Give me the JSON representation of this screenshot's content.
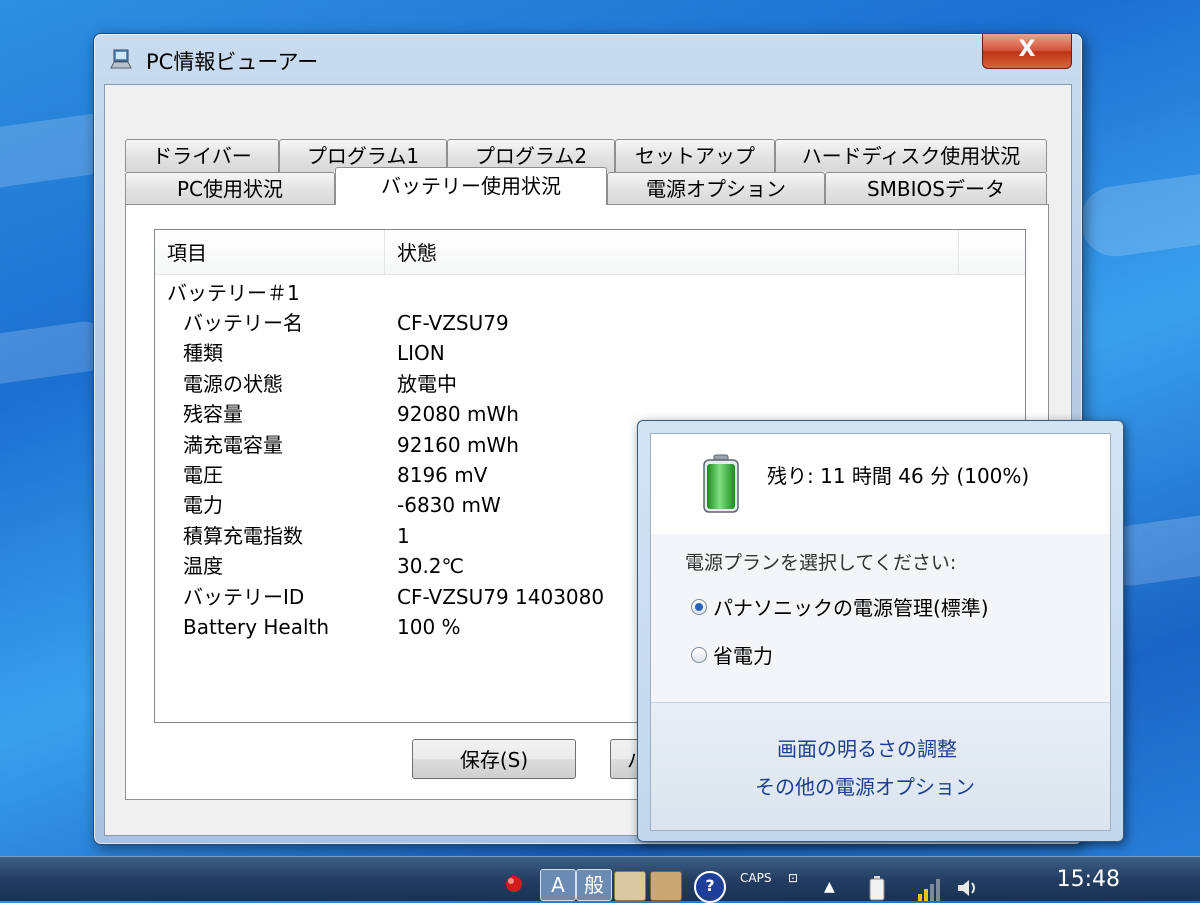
{
  "window": {
    "title": "PC情報ビューアー",
    "close_label": "X"
  },
  "tabs": {
    "row1": [
      "ドライバー",
      "プログラム1",
      "プログラム2",
      "セットアップ",
      "ハードディスク使用状況"
    ],
    "row2": [
      "PC使用状況",
      "バッテリー使用状況",
      "電源オプション",
      "SMBIOSデータ"
    ],
    "active": "バッテリー使用状況"
  },
  "list": {
    "headers": [
      "項目",
      "状態"
    ],
    "group": "バッテリー＃1",
    "rows": [
      {
        "item": "バッテリー名",
        "value": "CF-VZSU79"
      },
      {
        "item": "種類",
        "value": "LION"
      },
      {
        "item": "電源の状態",
        "value": "放電中"
      },
      {
        "item": "残容量",
        "value": "92080 mWh"
      },
      {
        "item": "満充電容量",
        "value": "92160 mWh"
      },
      {
        "item": "電圧",
        "value": "8196 mV"
      },
      {
        "item": "電力",
        "value": "-6830 mW"
      },
      {
        "item": "積算充電指数",
        "value": "1"
      },
      {
        "item": "温度",
        "value": "30.2℃"
      },
      {
        "item": "バッテリーID",
        "value": "CF-VZSU79      1403080"
      },
      {
        "item": "Battery Health",
        "value": "100 %"
      }
    ]
  },
  "buttons": {
    "save": "保存(S)",
    "second_partial": "パ"
  },
  "flyout": {
    "remaining": "残り: 11 時間 46 分 (100%)",
    "battery_level": 1.0,
    "plan_prompt": "電源プランを選択してください:",
    "plans": [
      {
        "label": "パナソニックの電源管理(標準)",
        "selected": true
      },
      {
        "label": "省電力",
        "selected": false
      }
    ],
    "link_brightness": "画面の明るさの調整",
    "link_more": "その他の電源オプション"
  },
  "taskbar": {
    "ime_mode": "A",
    "ime_kanji": "般",
    "caps_label": "CAPS",
    "clock": "15:48"
  },
  "colors": {
    "window_frame": "#b7cde6",
    "close_red": "#c8402a",
    "link_blue": "#1e3f8c",
    "battery_green": "#3ab53a",
    "desktop_blue": "#1c6fd0"
  }
}
